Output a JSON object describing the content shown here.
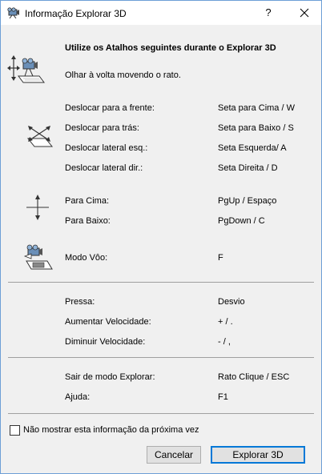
{
  "window": {
    "title": "Informação Explorar 3D",
    "help_label": "?",
    "border_color": "#6d9fd6"
  },
  "heading": "Utilize os Atalhos seguintes durante o Explorar 3D",
  "look_around": "Olhar à volta movendo o rato.",
  "movement": [
    {
      "label": "Deslocar para a frente:",
      "key": "Seta para Cima / W"
    },
    {
      "label": "Deslocar para trás:",
      "key": "Seta para Baixo / S"
    },
    {
      "label": "Deslocar lateral esq.:",
      "key": "Seta Esquerda/ A"
    },
    {
      "label": "Deslocar lateral dir.:",
      "key": "Seta Direita / D"
    }
  ],
  "vertical": [
    {
      "label": "Para Cima:",
      "key": "PgUp / Espaço"
    },
    {
      "label": "Para Baixo:",
      "key": "PgDown / C"
    }
  ],
  "flight": {
    "label": "Modo Vôo:",
    "key": "F"
  },
  "speed": [
    {
      "label": "Pressa:",
      "key": "Desvio"
    },
    {
      "label": "Aumentar Velocidade:",
      "key": "+ / ."
    },
    {
      "label": "Diminuir Velocidade:",
      "key": "- / ,"
    }
  ],
  "misc": [
    {
      "label": "Sair de modo Explorar:",
      "key": "Rato Clique / ESC"
    },
    {
      "label": "Ajuda:",
      "key": "F1"
    }
  ],
  "checkbox": {
    "label": "Não mostrar esta informação da próxima vez",
    "checked": false
  },
  "buttons": {
    "cancel": "Cancelar",
    "explore": "Explorar 3D"
  },
  "icons": {
    "title": "camera-app-icon",
    "look": "look-around-camera-icon",
    "move": "move-arrows-plane-icon",
    "updown": "up-down-arrows-icon",
    "fly": "fly-camera-icon"
  },
  "colors": {
    "accent": "#0078d7",
    "background": "#f0f0f0",
    "button": "#e1e1e1"
  }
}
